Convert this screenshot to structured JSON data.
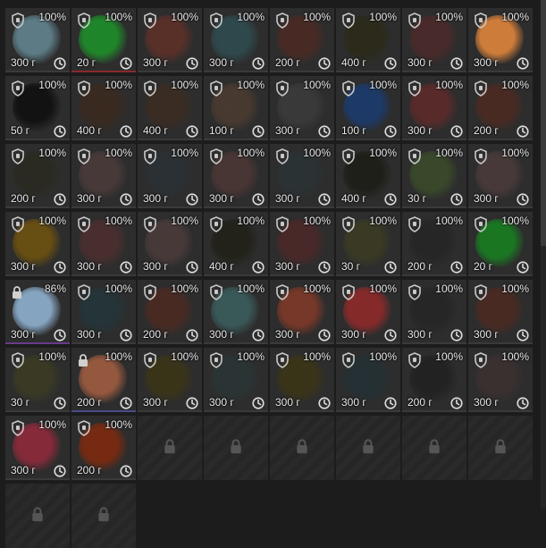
{
  "inventory": {
    "items": [
      {
        "percent": "100%",
        "price": "300 г",
        "color": "#5f7f8a",
        "rarity": "#3a3a3a",
        "locked": false
      },
      {
        "percent": "100%",
        "price": "20 г",
        "color": "#1f8a2a",
        "rarity": "#8a2a2a",
        "locked": false
      },
      {
        "percent": "100%",
        "price": "300 г",
        "color": "#5a3028",
        "rarity": "#3a3a3a",
        "locked": false
      },
      {
        "percent": "100%",
        "price": "300 г",
        "color": "#2f4a4e",
        "rarity": "#3a3a3a",
        "locked": false
      },
      {
        "percent": "100%",
        "price": "200 г",
        "color": "#4a2a24",
        "rarity": "#3a3a3a",
        "locked": false
      },
      {
        "percent": "100%",
        "price": "400 г",
        "color": "#2c2a1a",
        "rarity": "#3a3a3a",
        "locked": false
      },
      {
        "percent": "100%",
        "price": "300 г",
        "color": "#4a2a2a",
        "rarity": "#3a3a3a",
        "locked": false
      },
      {
        "percent": "100%",
        "price": "300 г",
        "color": "#d6803a",
        "rarity": "#3a3a3a",
        "locked": false
      },
      {
        "percent": "100%",
        "price": "50 г",
        "color": "#111111",
        "rarity": "#3a3a3a",
        "locked": false
      },
      {
        "percent": "100%",
        "price": "400 г",
        "color": "#3a2a20",
        "rarity": "#3a3a3a",
        "locked": false
      },
      {
        "percent": "100%",
        "price": "400 г",
        "color": "#3a2c22",
        "rarity": "#3a3a3a",
        "locked": false
      },
      {
        "percent": "100%",
        "price": "100 г",
        "color": "#4a3a30",
        "rarity": "#3a3a3a",
        "locked": false
      },
      {
        "percent": "100%",
        "price": "300 г",
        "color": "#3a3a3a",
        "rarity": "#3a3a3a",
        "locked": false
      },
      {
        "percent": "100%",
        "price": "100 г",
        "color": "#1c3a6a",
        "rarity": "#3a3a3a",
        "locked": false
      },
      {
        "percent": "100%",
        "price": "300 г",
        "color": "#5a2a2a",
        "rarity": "#3a3a3a",
        "locked": false
      },
      {
        "percent": "100%",
        "price": "200 г",
        "color": "#4a2a22",
        "rarity": "#3a3a3a",
        "locked": false
      },
      {
        "percent": "100%",
        "price": "200 г",
        "color": "#2a2a22",
        "rarity": "#3a3a3a",
        "locked": false
      },
      {
        "percent": "100%",
        "price": "300 г",
        "color": "#4a3a3a",
        "rarity": "#3a3a3a",
        "locked": false
      },
      {
        "percent": "100%",
        "price": "300 г",
        "color": "#2a3034",
        "rarity": "#3a3a3a",
        "locked": false
      },
      {
        "percent": "100%",
        "price": "300 г",
        "color": "#4a3634",
        "rarity": "#3a3a3a",
        "locked": false
      },
      {
        "percent": "100%",
        "price": "300 г",
        "color": "#2a3234",
        "rarity": "#3a3a3a",
        "locked": false
      },
      {
        "percent": "100%",
        "price": "400 г",
        "color": "#1e1e18",
        "rarity": "#3a3a3a",
        "locked": false
      },
      {
        "percent": "100%",
        "price": "30 г",
        "color": "#3a4a2a",
        "rarity": "#3a3a3a",
        "locked": false
      },
      {
        "percent": "100%",
        "price": "300 г",
        "color": "#4a3a3a",
        "rarity": "#3a3a3a",
        "locked": false
      },
      {
        "percent": "100%",
        "price": "300 г",
        "color": "#6a5010",
        "rarity": "#3a3a3a",
        "locked": false
      },
      {
        "percent": "100%",
        "price": "300 г",
        "color": "#4a2e2e",
        "rarity": "#3a3a3a",
        "locked": false
      },
      {
        "percent": "100%",
        "price": "300 г",
        "color": "#4a3a3a",
        "rarity": "#3a3a3a",
        "locked": false
      },
      {
        "percent": "100%",
        "price": "400 г",
        "color": "#22221a",
        "rarity": "#3a3a3a",
        "locked": false
      },
      {
        "percent": "100%",
        "price": "300 г",
        "color": "#4a2828",
        "rarity": "#3a3a3a",
        "locked": false
      },
      {
        "percent": "100%",
        "price": "30 г",
        "color": "#3a3a24",
        "rarity": "#3a3a3a",
        "locked": false
      },
      {
        "percent": "100%",
        "price": "200 г",
        "color": "#262626",
        "rarity": "#3a3a3a",
        "locked": false
      },
      {
        "percent": "100%",
        "price": "20 г",
        "color": "#1a7a22",
        "rarity": "#3a3a3a",
        "locked": false
      },
      {
        "percent": "86%",
        "price": "300 г",
        "color": "#8aaac8",
        "rarity": "#6a3a8a",
        "locked": true
      },
      {
        "percent": "100%",
        "price": "300 г",
        "color": "#243438",
        "rarity": "#3a3a3a",
        "locked": false
      },
      {
        "percent": "100%",
        "price": "200 г",
        "color": "#4a2a22",
        "rarity": "#3a3a3a",
        "locked": false
      },
      {
        "percent": "100%",
        "price": "300 г",
        "color": "#3a5a5a",
        "rarity": "#3a3a3a",
        "locked": false
      },
      {
        "percent": "100%",
        "price": "300 г",
        "color": "#7a3828",
        "rarity": "#3a3a3a",
        "locked": false
      },
      {
        "percent": "100%",
        "price": "300 г",
        "color": "#8a2a2a",
        "rarity": "#3a3a3a",
        "locked": false
      },
      {
        "percent": "100%",
        "price": "300 г",
        "color": "#262626",
        "rarity": "#3a3a3a",
        "locked": false
      },
      {
        "percent": "100%",
        "price": "300 г",
        "color": "#4a2a22",
        "rarity": "#3a3a3a",
        "locked": false
      },
      {
        "percent": "100%",
        "price": "30 г",
        "color": "#3a3a24",
        "rarity": "#3a3a3a",
        "locked": false
      },
      {
        "percent": "100%",
        "price": "200 г",
        "color": "#9a5a40",
        "rarity": "#4a4a8a",
        "locked": true
      },
      {
        "percent": "100%",
        "price": "300 г",
        "color": "#3a3418",
        "rarity": "#3a3a3a",
        "locked": false
      },
      {
        "percent": "100%",
        "price": "300 г",
        "color": "#2a3434",
        "rarity": "#3a3a3a",
        "locked": false
      },
      {
        "percent": "100%",
        "price": "300 г",
        "color": "#3a3418",
        "rarity": "#3a3a3a",
        "locked": false
      },
      {
        "percent": "100%",
        "price": "300 г",
        "color": "#243034",
        "rarity": "#3a3a3a",
        "locked": false
      },
      {
        "percent": "100%",
        "price": "200 г",
        "color": "#222222",
        "rarity": "#3a3a3a",
        "locked": false
      },
      {
        "percent": "100%",
        "price": "300 г",
        "color": "#3a3030",
        "rarity": "#3a3a3a",
        "locked": false
      },
      {
        "percent": "100%",
        "price": "300 г",
        "color": "#8a2a3a",
        "rarity": "#3a3a3a",
        "locked": false
      },
      {
        "percent": "100%",
        "price": "200 г",
        "color": "#7a2a10",
        "rarity": "#3a3a3a",
        "locked": false
      }
    ],
    "empty_slots": 8
  }
}
